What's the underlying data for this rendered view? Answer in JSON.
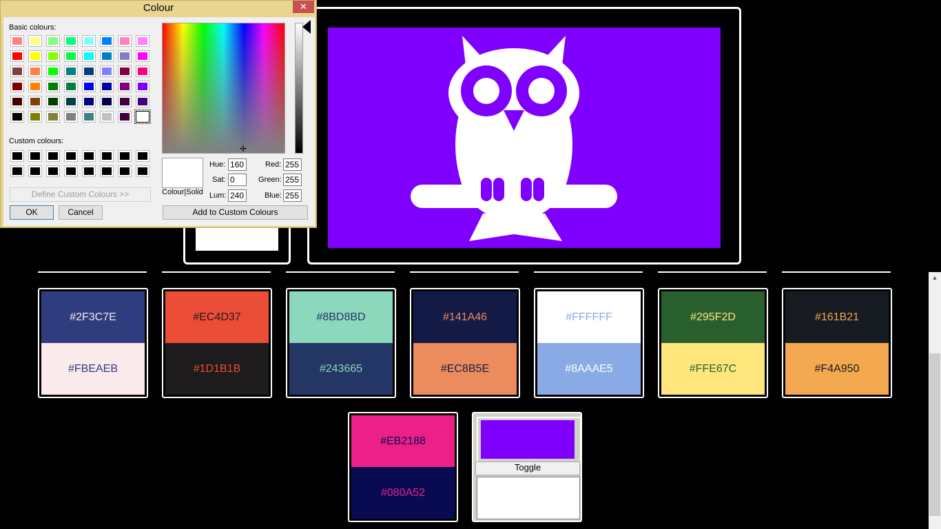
{
  "dialog": {
    "title": "Colour",
    "close_label": "✕",
    "basic_colours_label": "Basic colours:",
    "custom_colours_label": "Custom colours:",
    "define_custom_label": "Define Custom Colours >>",
    "ok_label": "OK",
    "cancel_label": "Cancel",
    "colour_solid_label": "Colour|Solid",
    "add_custom_label": "Add to Custom Colours",
    "hue_label": "Hue:",
    "sat_label": "Sat:",
    "lum_label": "Lum:",
    "red_label": "Red:",
    "green_label": "Green:",
    "blue_label": "Blue:",
    "hue": "160",
    "sat": "0",
    "lum": "240",
    "red": "255",
    "green": "255",
    "blue": "255",
    "basic_colours": [
      [
        "#ff8080",
        "#ffff80",
        "#80ff80",
        "#00ff80",
        "#80ffff",
        "#0080ff",
        "#ff80c0",
        "#ff80ff"
      ],
      [
        "#ff0000",
        "#ffff00",
        "#80ff00",
        "#00ff40",
        "#00ffff",
        "#0080c0",
        "#8080c0",
        "#ff00ff"
      ],
      [
        "#804040",
        "#ff8040",
        "#00ff00",
        "#008080",
        "#004080",
        "#8080ff",
        "#800040",
        "#ff0080"
      ],
      [
        "#800000",
        "#ff8000",
        "#008000",
        "#008040",
        "#0000ff",
        "#0000a0",
        "#800080",
        "#8000ff"
      ],
      [
        "#400000",
        "#804000",
        "#004000",
        "#004040",
        "#000080",
        "#000040",
        "#400040",
        "#400080"
      ],
      [
        "#000000",
        "#808000",
        "#808040",
        "#808080",
        "#408080",
        "#c0c0c0",
        "#400040",
        "#ffffff"
      ]
    ],
    "selected_basic_colour": "#ffffff",
    "custom_colours": [
      [
        "#000000",
        "#000000",
        "#000000",
        "#000000",
        "#000000",
        "#000000",
        "#000000",
        "#000000"
      ],
      [
        "#000000",
        "#000000",
        "#000000",
        "#000000",
        "#000000",
        "#000000",
        "#000000",
        "#000000"
      ]
    ]
  },
  "preview": {
    "background": "#8000ff",
    "owl_colour": "#ffffff"
  },
  "swatches": [
    {
      "top_hex": "#2F3C7E",
      "bottom_hex": "#FBEAEB",
      "top_text": "#2F3C7E",
      "bottom_text": "#FBEAEB",
      "top_text_colour": "#FBEAEB",
      "bottom_text_colour": "#2F3C7E"
    },
    {
      "top_hex": "#EC4D37",
      "bottom_hex": "#1D1B1B",
      "top_text": "#EC4D37",
      "bottom_text": "#1D1B1B",
      "top_text_colour": "#1D1B1B",
      "bottom_text_colour": "#EC4D37"
    },
    {
      "top_hex": "#8BD8BD",
      "bottom_hex": "#243665",
      "top_text": "#8BD8BD",
      "bottom_text": "#243665",
      "top_text_colour": "#243665",
      "bottom_text_colour": "#8BD8BD"
    },
    {
      "top_hex": "#141A46",
      "bottom_hex": "#EC8B5E",
      "top_text": "#141A46",
      "bottom_text": "#EC8B5E",
      "top_text_colour": "#EC8B5E",
      "bottom_text_colour": "#141A46"
    },
    {
      "top_hex": "#FFFFFF",
      "bottom_hex": "#8AAAE5",
      "top_text": "#FFFFFF",
      "bottom_text": "#8AAAE5",
      "top_text_colour": "#8AAAE5",
      "bottom_text_colour": "#FFFFFF"
    },
    {
      "top_hex": "#295F2D",
      "bottom_hex": "#FFE67C",
      "top_text": "#295F2D",
      "bottom_text": "#FFE67C",
      "top_text_colour": "#FFE67C",
      "bottom_text_colour": "#295F2D"
    },
    {
      "top_hex": "#161B21",
      "bottom_hex": "#F4A950",
      "top_text": "#161B21",
      "bottom_text": "#F4A950",
      "top_text_colour": "#F4A950",
      "bottom_text_colour": "#161B21"
    },
    {
      "top_hex": "#EB2188",
      "bottom_hex": "#080A52",
      "top_text": "#EB2188",
      "bottom_text": "#080A52",
      "top_text_colour": "#080A52",
      "bottom_text_colour": "#EB2188"
    }
  ],
  "toggle": {
    "label": "Toggle",
    "top_colour": "#8000ff",
    "bottom_colour": "#ffffff"
  },
  "scrollbar": {
    "up_arrow": "▲"
  }
}
